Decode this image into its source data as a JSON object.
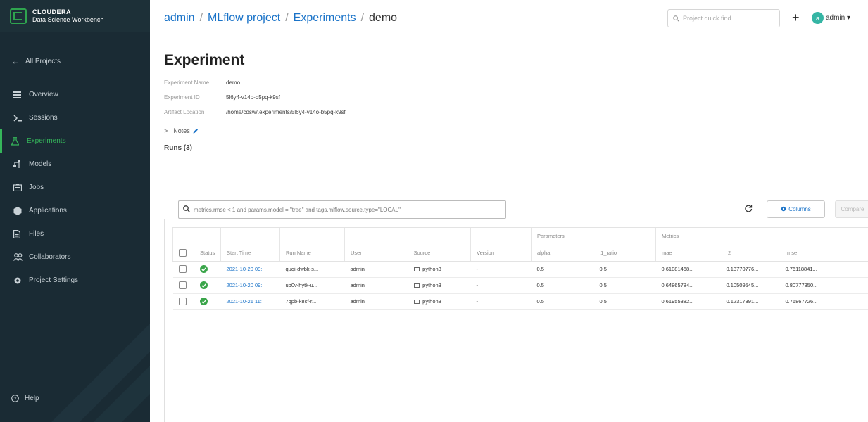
{
  "brand": {
    "name": "CLOUDERA",
    "subtitle": "Data Science Workbench"
  },
  "sidebar": {
    "back_label": "All Projects",
    "items": [
      {
        "label": "Overview",
        "icon": "overview-icon",
        "active": false
      },
      {
        "label": "Sessions",
        "icon": "terminal-icon",
        "active": false
      },
      {
        "label": "Experiments",
        "icon": "flask-icon",
        "active": true
      },
      {
        "label": "Models",
        "icon": "models-icon",
        "active": false
      },
      {
        "label": "Jobs",
        "icon": "jobs-icon",
        "active": false
      },
      {
        "label": "Applications",
        "icon": "applications-icon",
        "active": false
      },
      {
        "label": "Files",
        "icon": "file-icon",
        "active": false
      },
      {
        "label": "Collaborators",
        "icon": "collaborators-icon",
        "active": false
      },
      {
        "label": "Project Settings",
        "icon": "gear-icon",
        "active": false
      }
    ],
    "help_label": "Help"
  },
  "breadcrumb": {
    "user": "admin",
    "project": "MLflow project",
    "section": "Experiments",
    "current": "demo",
    "separator": "/"
  },
  "header": {
    "search_placeholder": "Project quick find",
    "plus": "+",
    "user_initial": "a",
    "user_label": "admin ▾"
  },
  "experiment": {
    "title": "Experiment",
    "name_label": "Experiment Name",
    "name_value": "demo",
    "id_label": "Experiment ID",
    "id_value": "5l6y4-v14o-b5pq-k9sf",
    "artifact_label": "Artifact Location",
    "artifact_value": "/home/cdsw/.experiments/5l6y4-v14o-b5pq-k9sf",
    "notes_label": "Notes",
    "runs_label": "Runs (3)"
  },
  "toolbar": {
    "filter_value": "metrics.rmse < 1 and params.model = \"tree\" and tags.mlflow.source.type=\"LOCAL\"",
    "columns_label": "Columns",
    "compare_label": "Compare"
  },
  "table": {
    "group_headers": {
      "parameters": "Parameters",
      "metrics": "Metrics"
    },
    "columns": [
      "Status",
      "Start Time",
      "Run Name",
      "User",
      "Source",
      "Version",
      "alpha",
      "l1_ratio",
      "mae",
      "r2",
      "rmse"
    ],
    "rows": [
      {
        "start_time": "2021-10-20 09:",
        "run_name": "quqi-dwbk-s...",
        "user": "admin",
        "source": "ipython3",
        "version": "-",
        "alpha": "0.5",
        "l1_ratio": "0.5",
        "mae": "0.61081468...",
        "r2": "0.13770776...",
        "rmse": "0.76118841..."
      },
      {
        "start_time": "2021-10-20 09:",
        "run_name": "ub0v-hytk-u...",
        "user": "admin",
        "source": "ipython3",
        "version": "-",
        "alpha": "0.5",
        "l1_ratio": "0.5",
        "mae": "0.64865784...",
        "r2": "0.10509545...",
        "rmse": "0.80777350..."
      },
      {
        "start_time": "2021-10-21 11:",
        "run_name": "7qpb-k8cf-r...",
        "user": "admin",
        "source": "ipython3",
        "version": "-",
        "alpha": "0.5",
        "l1_ratio": "0.5",
        "mae": "0.61955382...",
        "r2": "0.12317391...",
        "rmse": "0.76867726..."
      }
    ]
  },
  "colors": {
    "sidebar_bg": "#1a2b34",
    "accent_green": "#35b55a",
    "link_blue": "#1a73c8"
  }
}
